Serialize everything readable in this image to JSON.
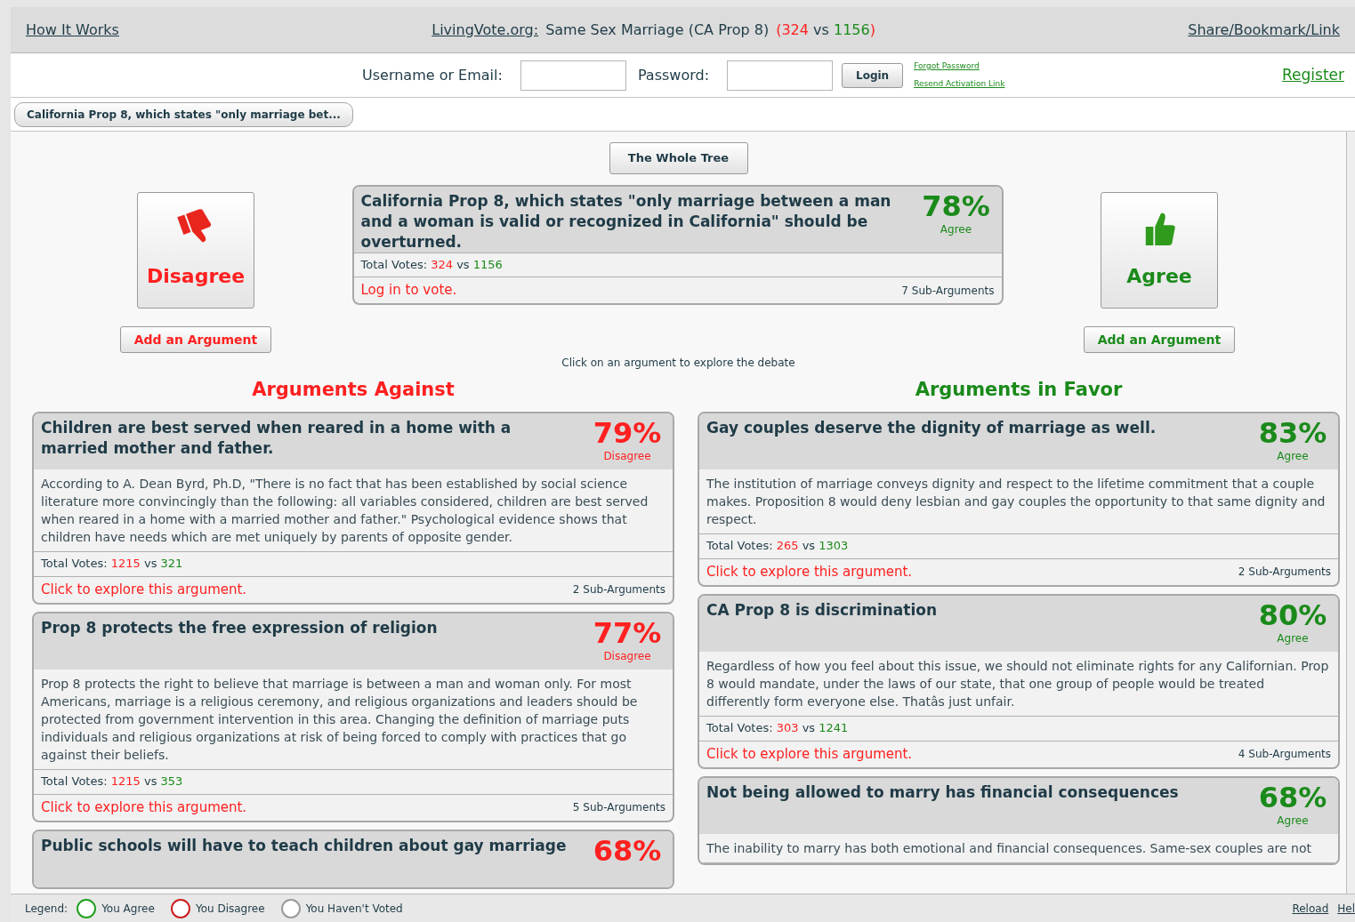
{
  "header": {
    "how_it_works": "How It Works",
    "site": "LivingVote.org:",
    "topic": "Same Sex Marriage (CA Prop 8)",
    "open": "(",
    "against": "324",
    "vs": "vs",
    "for": "1156",
    "close": ")",
    "share": "Share/Bookmark/Link"
  },
  "login": {
    "username_label": "Username or Email:",
    "password_label": "Password:",
    "button": "Login",
    "forgot": "Forgot Password",
    "resend": "Resend Activation Link",
    "register": "Register"
  },
  "breadcrumb": "California Prop 8, which states \"only marriage bet...",
  "whole_tree": "The Whole Tree",
  "disagree_panel": {
    "label": "Disagree",
    "add": "Add an Argument"
  },
  "agree_panel": {
    "label": "Agree",
    "add": "Add an Argument"
  },
  "main_card": {
    "title": "California Prop 8, which states \"only marriage between a man and a woman is valid or recognized in California\" should be overturned.",
    "color": "#1a8a1a",
    "percent": "78%",
    "verdict": "Agree",
    "votes_label": "Total Votes:",
    "against": "324",
    "vs": "vs",
    "for": "1156",
    "action": "Log in to vote.",
    "sub": "7 Sub-Arguments"
  },
  "hint": "Click on an argument to explore the debate",
  "against": {
    "heading": "Arguments Against",
    "cards": [
      {
        "title": "Children are best served when reared in a home with a married mother and father.",
        "color": "#ff2020",
        "percent": "79%",
        "verdict": "Disagree",
        "body": "According to A. Dean Byrd, Ph.D, \"There is no fact that has been established by social science literature more convincingly than the following: all variables considered, children are best served when reared in a home with a married mother and father.\" Psychological evidence shows that children have needs which are met uniquely by parents of opposite gender.",
        "votes_label": "Total Votes:",
        "against": "1215",
        "vs": "vs",
        "for": "321",
        "action": "Click to explore this argument.",
        "sub": "2 Sub-Arguments"
      },
      {
        "title": "Prop 8 protects the free expression of religion",
        "color": "#ff2020",
        "percent": "77%",
        "verdict": "Disagree",
        "body": "Prop 8 protects the right to believe that marriage is between a man and woman only.  For most Americans, marriage is a religious ceremony, and religious organizations and leaders should be protected from government intervention in this area.  Changing the definition of marriage puts individuals and religious organizations at risk of being forced to comply with practices that go against their beliefs.",
        "votes_label": "Total Votes:",
        "against": "1215",
        "vs": "vs",
        "for": "353",
        "action": "Click to explore this argument.",
        "sub": "5 Sub-Arguments"
      },
      {
        "title": "Public schools will have to teach children about gay marriage",
        "color": "#ff2020",
        "percent": "68%"
      }
    ]
  },
  "favor": {
    "heading": "Arguments in Favor",
    "cards": [
      {
        "title": "Gay couples deserve the dignity of marriage as well.",
        "color": "#1a8a1a",
        "percent": "83%",
        "verdict": "Agree",
        "body": "The institution of marriage conveys dignity and respect to the lifetime commitment that a couple makes. Proposition 8 would deny lesbian and gay couples the opportunity to that same dignity and respect.",
        "votes_label": "Total Votes:",
        "against": "265",
        "vs": "vs",
        "for": "1303",
        "action": "Click to explore this argument.",
        "sub": "2 Sub-Arguments"
      },
      {
        "title": "CA Prop 8 is discrimination",
        "color": "#1a8a1a",
        "percent": "80%",
        "verdict": "Agree",
        "body": "Regardless of how you feel about this issue, we should not eliminate rights for any Californian. Prop 8 would mandate, under the laws of our state, that one group of people would be treated differently form everyone else. Thatâs just unfair.",
        "votes_label": "Total Votes:",
        "against": "303",
        "vs": "vs",
        "for": "1241",
        "action": "Click to explore this argument.",
        "sub": "4 Sub-Arguments"
      },
      {
        "title": "Not being allowed to marry has financial consequences",
        "color": "#1a8a1a",
        "percent": "68%",
        "verdict": "Agree",
        "body": "The inability to marry has both emotional and financial consequences. Same-sex couples are not"
      }
    ]
  },
  "footer": {
    "legend": "Legend:",
    "items": [
      {
        "label": "You Agree",
        "color": "#22a022"
      },
      {
        "label": "You Disagree",
        "color": "#cc1f1f"
      },
      {
        "label": "You Haven't Voted",
        "color": "#9a9a9a"
      }
    ],
    "reload": "Reload",
    "help": "Hel"
  }
}
